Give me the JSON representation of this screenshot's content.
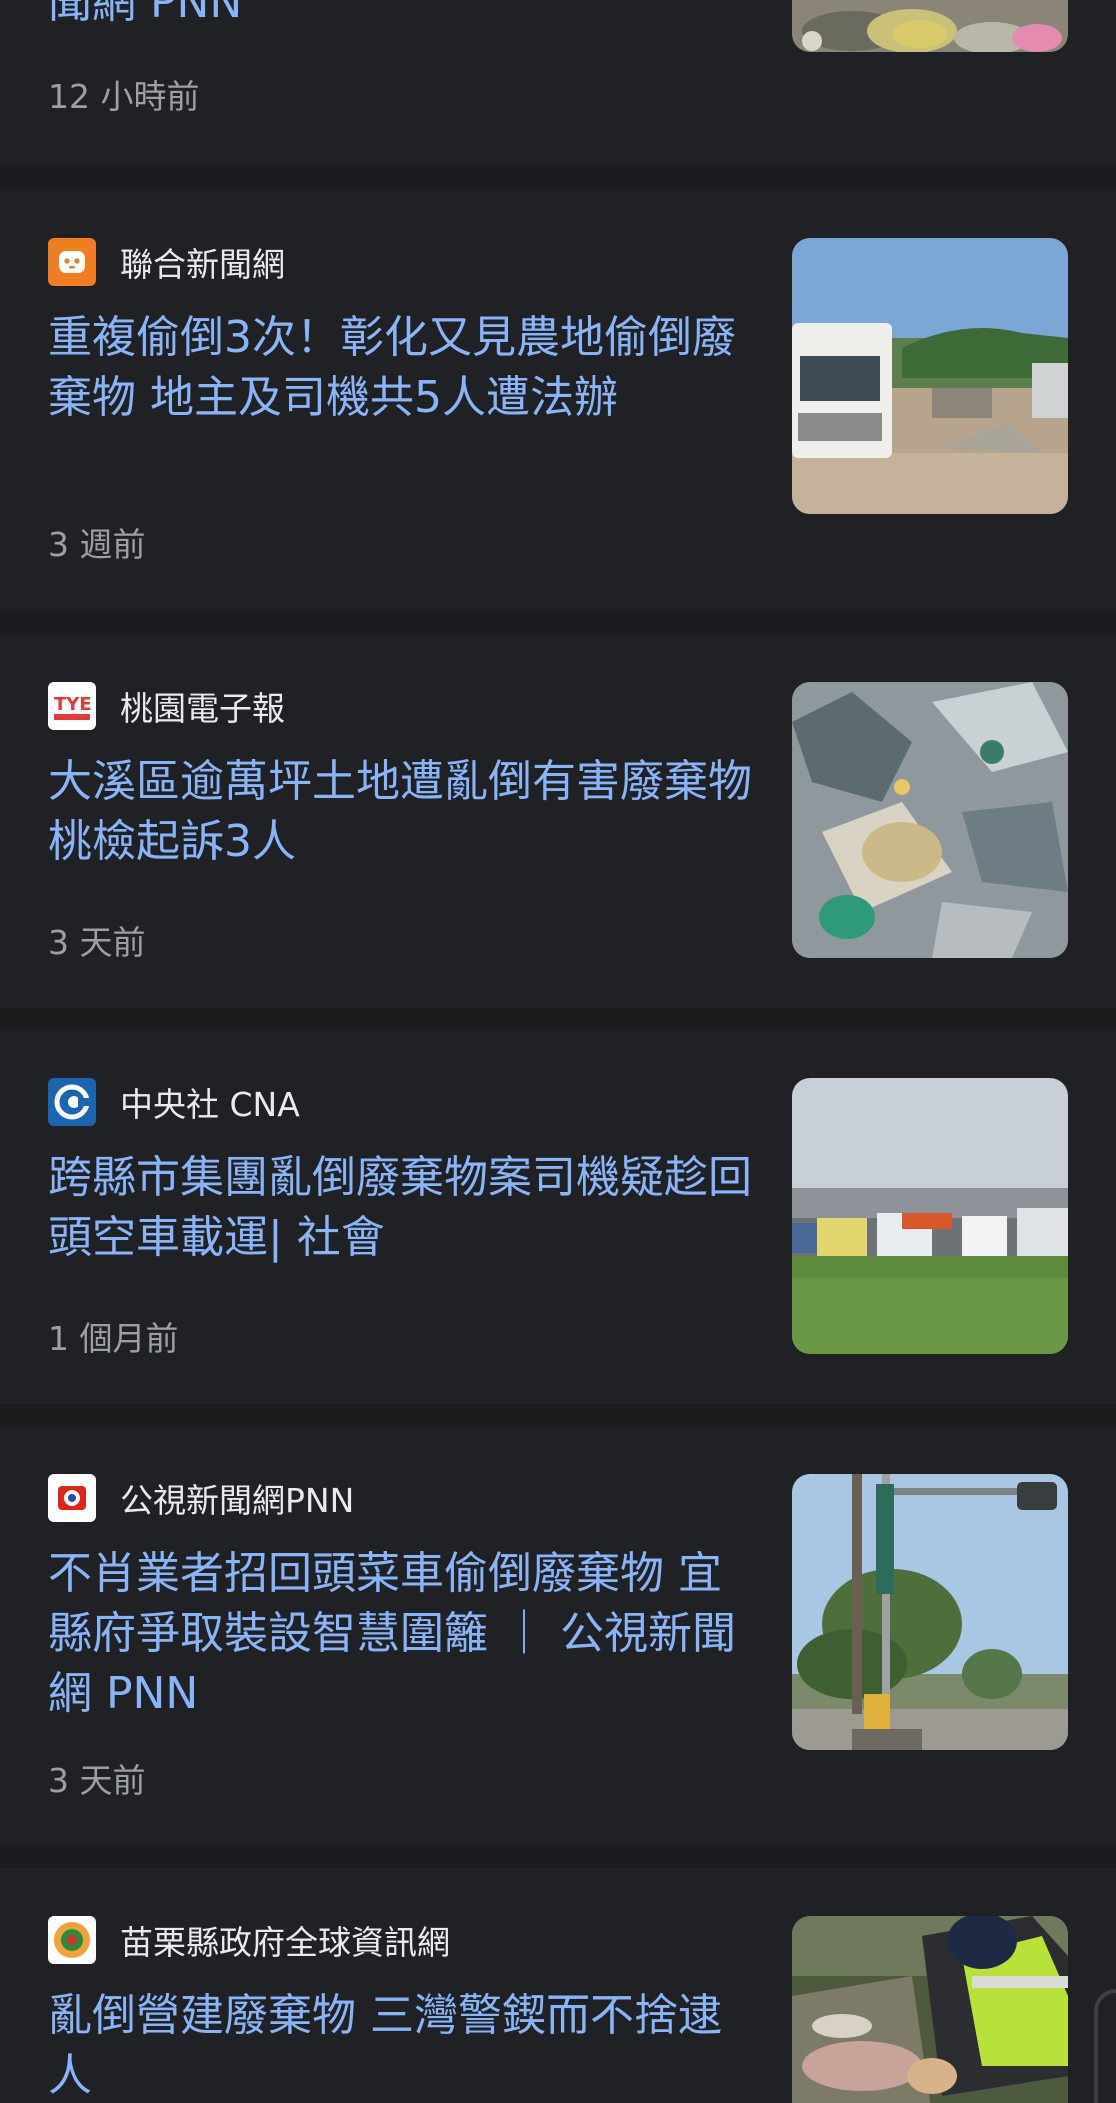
{
  "articles": [
    {
      "source": "",
      "headline": "聞網 PNN",
      "time": "12 小時前",
      "favicon": "partial",
      "thumb": "trash-pile"
    },
    {
      "source": "聯合新聞網",
      "headline": "重複偷倒3次！彰化又見農地偷倒廢棄物 地主及司機共5人遭法辦",
      "time": "3 週前",
      "favicon": "udn-icon",
      "thumb": "trucks-site"
    },
    {
      "source": "桃園電子報",
      "headline": "大溪區逾萬坪土地遭亂倒有害廢棄物 桃檢起訴3人",
      "time": "3 天前",
      "favicon": "tye-icon",
      "thumb": "debris-pile"
    },
    {
      "source": "中央社 CNA",
      "headline": "跨縣市集團亂倒廢棄物案司機疑趁回頭空車載運| 社會",
      "time": "1 個月前",
      "favicon": "cna-icon",
      "thumb": "truck-lineup"
    },
    {
      "source": "公視新聞網PNN",
      "headline": "不肖業者招回頭菜車偷倒廢棄物 宜縣府爭取裝設智慧圍籬 ｜ 公視新聞網 PNN",
      "time": "3 天前",
      "favicon": "pts-icon",
      "thumb": "street-pole"
    },
    {
      "source": "苗栗縣政府全球資訊網",
      "headline": "亂倒營建廢棄物 三灣警鍥而不捨逮人",
      "time": "",
      "favicon": "miaoli-icon",
      "thumb": "officer-inspect"
    }
  ],
  "colors": {
    "background": "#1b1c1e",
    "card": "#202124",
    "headline": "#8ab4f8",
    "source": "#e8eaed",
    "timestamp": "#9aa0a6"
  }
}
